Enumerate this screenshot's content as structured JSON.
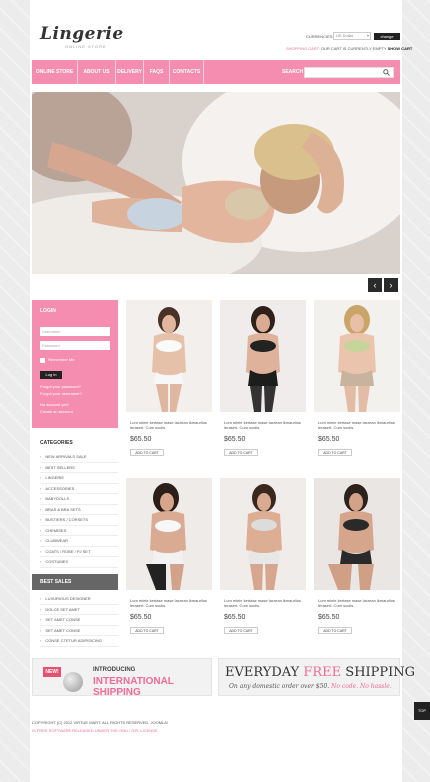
{
  "header": {
    "logo": "Lingerie",
    "logo_sub": "ONLINE STORE",
    "currencies_label": "CURRENCIES:",
    "currency_value": "US Dollar",
    "change_button": "change",
    "cart_label": "SHOPPING CART:",
    "cart_status": "OUR CART IS CURRENTLY EMPTY",
    "show_cart": "SHOW CART"
  },
  "nav": {
    "items": [
      "ONLINE STORE",
      "ABOUT US",
      "DELIVERY",
      "FAQS",
      "CONTACTS"
    ],
    "search_label": "SEARCH"
  },
  "slider": {
    "prev": "‹",
    "next": "›"
  },
  "login": {
    "title": "LOGIN",
    "username_placeholder": "Username",
    "password_placeholder": "Password",
    "remember": "Remember Me",
    "button": "Log in",
    "forgot_password": "Forgot your password?",
    "forgot_username": "Forgot your username?",
    "no_account": "No account yet?",
    "create_account": "Create an account"
  },
  "categories": {
    "title": "CATEGORIES",
    "items": [
      "NEW ARRIVALS SALE",
      "BEST SELLERS",
      "LINGERIE",
      "ACCESSORIES",
      "BABYDOLLS",
      "BRAS & BRA SETS",
      "BUSTIERS / CORSETS",
      "CHEMISES",
      "CLUBWEAR",
      "COATS / ROBE / PJ SET",
      "COSTUMES",
      "MEN'S WEAR"
    ]
  },
  "best_sales": {
    "title": "BEST SALES",
    "items": [
      "LUXURIOUS DESIGNER",
      "DOLCE SET AMET",
      "SET AMET CONSE",
      "SET AMET CONSE",
      "CONSE CTETUR ADIPISICING"
    ]
  },
  "products": [
    {
      "desc": "Lum mleie kertase mase lacrean ikmaurlius lerasert. Cum sociis.",
      "price": "$65.50",
      "button": "ADD TO CART"
    },
    {
      "desc": "Lum mleie kertase mase lacrean ikmaurlius lerasert. Cum sociis.",
      "price": "$65.50",
      "button": "ADD TO CART"
    },
    {
      "desc": "Lum mleie kertase mase lacrean ikmaurlius lerasert. Cum sociis.",
      "price": "$65.50",
      "button": "ADD TO CART"
    },
    {
      "desc": "Lum mleie kertase mase lacrean ikmaurlius lerasert. Cum sociis.",
      "price": "$65.50",
      "button": "ADD TO CART"
    },
    {
      "desc": "Lum mleie kertase mase lacrean ikmaurlius lerasert. Cum sociis.",
      "price": "$65.50",
      "button": "ADD TO CART"
    },
    {
      "desc": "Lum mleie kertase mase lacrean ikmaurlius lerasert. Cum sociis.",
      "price": "$65.50",
      "button": "ADD TO CART"
    }
  ],
  "banners": {
    "new_badge": "NEW!",
    "introducing": "INTRODUCING",
    "international": "INTERNATIONAL SHIPPING",
    "everyday": "EVERYDAY",
    "free": "FREE",
    "shipping": "SHIPPING",
    "on_any": "On any domestic order over $50.",
    "no_code": "No code. No hassle."
  },
  "footer": {
    "copyright": "COPYRIGHT (C) 2012 VIRTUE MART. ALL RIGHTS RESERVED. JOOMLA!",
    "license": "IS FREE SOFTWARE RELEASED UNDER THE GNU / GPL LICENSE"
  },
  "scroll_tab": "TOP",
  "colors": {
    "accent": "#f58db0",
    "dark": "#222222",
    "price_pink": "#f06b96"
  }
}
